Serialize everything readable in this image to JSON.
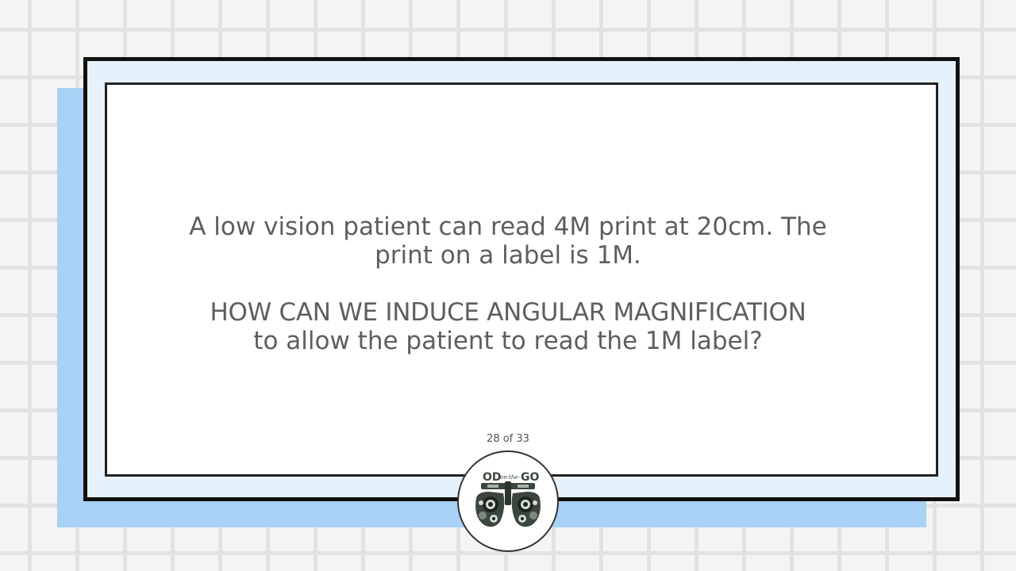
{
  "slide": {
    "line1": "A low vision patient can read 4M print at 20cm. The",
    "line2": "print on a label is 1M.",
    "question_caps": "HOW CAN WE INDUCE ANGULAR MAGNIFICATION",
    "question_rest": "to allow the patient to read the 1M label?"
  },
  "footer": {
    "page_counter": "28 of 33"
  },
  "logo": {
    "text_left": "OD",
    "text_mid": "on-the-",
    "text_right": "GO",
    "icon": "phoropter-icon"
  },
  "colors": {
    "background": "#f4f4f4",
    "grid": "#e2e2e2",
    "shadow_card": "#a9d0f5",
    "frame_fill": "#e6f1fa",
    "text": "#5e5e5e",
    "logo_dark": "#3b463d"
  }
}
